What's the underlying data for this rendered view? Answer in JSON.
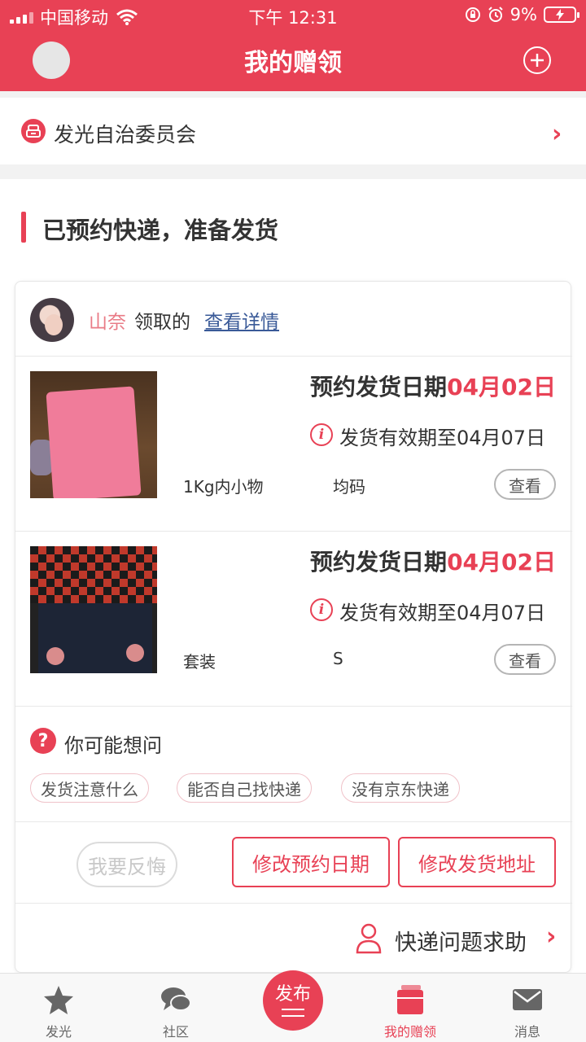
{
  "status_bar": {
    "carrier": "中国移动",
    "time": "下午 12:31",
    "battery": "9%"
  },
  "header": {
    "title": "我的赠领"
  },
  "committee": {
    "label": "发光自治委员会"
  },
  "section": {
    "title": "已预约快递，准备发货"
  },
  "card": {
    "recipient": "山奈",
    "received_label": "领取的",
    "detail_link": "查看详情",
    "items": [
      {
        "date_label": "预约发货日期",
        "date_value": "04月02日",
        "valid_text": "发货有效期至04月07日",
        "category": "1Kg内小物",
        "size": "均码",
        "view_label": "查看"
      },
      {
        "date_label": "预约发货日期",
        "date_value": "04月02日",
        "valid_text": "发货有效期至04月07日",
        "category": "套装",
        "size": "S",
        "view_label": "查看"
      }
    ],
    "faq": {
      "title": "你可能想问",
      "chips": [
        "发货注意什么",
        "能否自己找快递",
        "没有京东快递"
      ]
    },
    "actions": {
      "regret": "我要反悔",
      "change_date": "修改预约日期",
      "change_address": "修改发货地址"
    },
    "help": {
      "label": "快递问题求助"
    }
  },
  "tabbar": {
    "items": [
      {
        "label": "发光"
      },
      {
        "label": "社区"
      },
      {
        "label": "发布"
      },
      {
        "label": "我的赠领"
      },
      {
        "label": "消息"
      }
    ]
  },
  "colors": {
    "brand": "#e84155",
    "link": "#3a5a98"
  }
}
